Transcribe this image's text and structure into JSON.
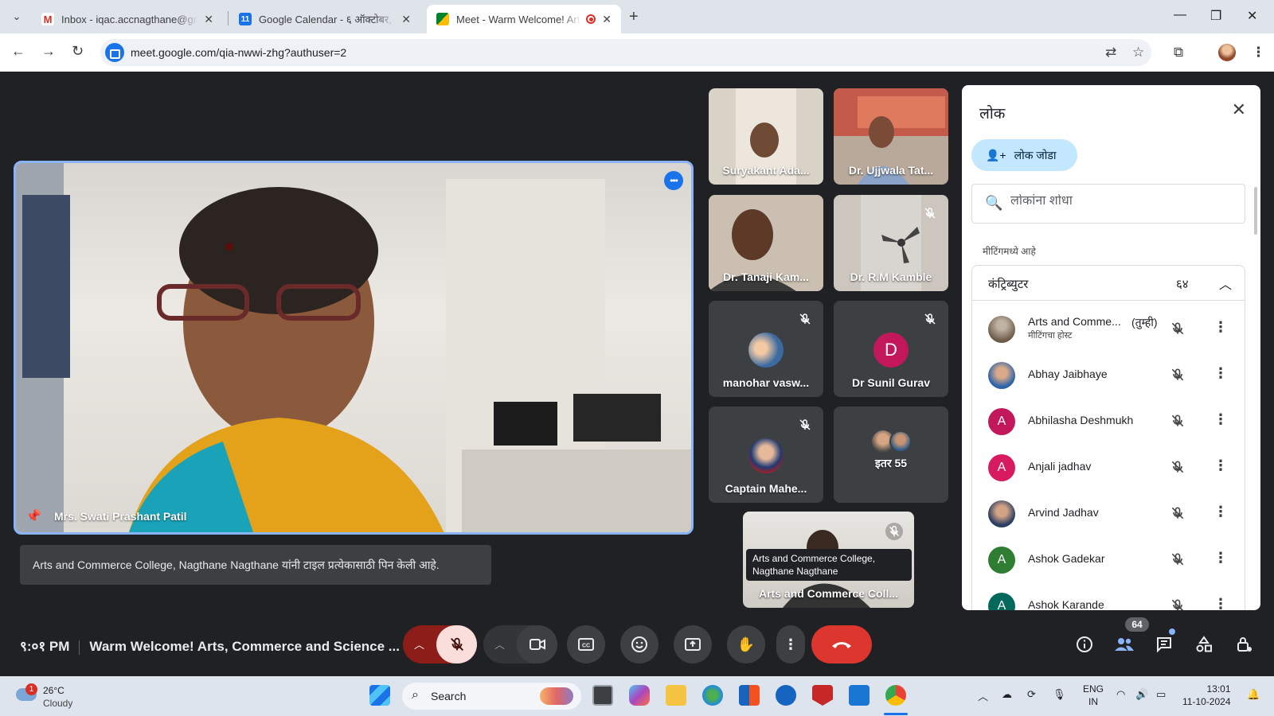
{
  "browser": {
    "tabs": [
      {
        "title": "Inbox - iqac.accnagthane@gma",
        "favicon": "gmail-icon"
      },
      {
        "title": "Google Calendar - ६ ऑक्टोबर, २",
        "favicon": "calendar-icon"
      },
      {
        "title": "Meet - Warm Welcome! Art",
        "favicon": "meet-icon",
        "active": true,
        "recording": true
      }
    ],
    "url": "meet.google.com/qia-nwwi-zhg?authuser=2"
  },
  "main_tile": {
    "name": "Mrs. Swati Prashant Patil"
  },
  "grid": [
    {
      "name": "Suryakant Ada...",
      "muted": false
    },
    {
      "name": "Dr. Ujjwala Tat...",
      "muted": false
    },
    {
      "name": "Dr. Tanaji Kam...",
      "muted": false
    },
    {
      "name": "Dr. R.M Kamble",
      "muted": true
    },
    {
      "name": "manohar vasw...",
      "muted": true
    },
    {
      "name": "Dr Sunil Gurav",
      "muted": true,
      "initial": "D"
    },
    {
      "name": "Captain Mahe...",
      "muted": true
    },
    {
      "name": "इतर 55",
      "muted": false
    }
  ],
  "pinned_notice": "Arts and Commerce College, Nagthane Nagthane यांनी टाइल प्रत्येकासाठी पिन केली आहे.",
  "self_tile": {
    "name": "Arts and Commerce Coll...",
    "tooltip": "Arts and Commerce College, Nagthane Nagthane"
  },
  "people_panel": {
    "title": "लोक",
    "add_people": "लोक जोडा",
    "search_placeholder": "लोकांना शोधा",
    "section_label": "मीटिंगमध्ये आहे",
    "contributors_label": "कंट्रिब्युटर",
    "contributors_count": "६४",
    "people": [
      {
        "name": "Arts and Comme...",
        "you": "(तुम्ही)",
        "role": "मीटिंगचा होस्ट",
        "avatar": "photo",
        "color": "#8d7b68"
      },
      {
        "name": "Abhay Jaibhaye",
        "avatar": "photo",
        "color": "#3a6ea5"
      },
      {
        "name": "Abhilasha Deshmukh",
        "avatar": "A",
        "color": "#c2185b"
      },
      {
        "name": "Anjali jadhav",
        "avatar": "A",
        "color": "#d81b60"
      },
      {
        "name": "Arvind Jadhav",
        "avatar": "photo",
        "color": "#5c6b8a"
      },
      {
        "name": "Ashok Gadekar",
        "avatar": "A",
        "color": "#2e7d32"
      },
      {
        "name": "Ashok Karande",
        "avatar": "A",
        "color": "#00695c"
      }
    ]
  },
  "bottom_bar": {
    "time": "९:०१ PM",
    "meeting_title": "Warm Welcome! Arts, Commerce and Science ...",
    "participant_count": "64"
  },
  "taskbar": {
    "temperature": "26°C",
    "weather": "Cloudy",
    "weather_badge": "1",
    "search": "Search",
    "lang1": "ENG",
    "lang2": "IN",
    "time": "13:01",
    "date": "11-10-2024"
  }
}
